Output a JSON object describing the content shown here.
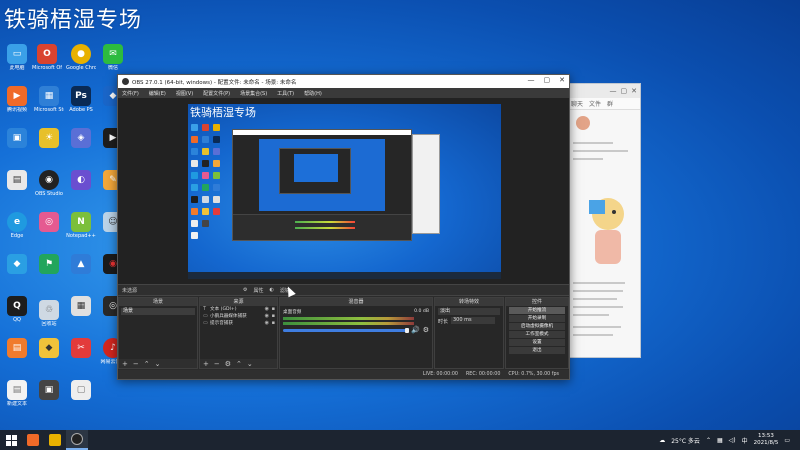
{
  "overlay_title": "铁骑梧湿专场",
  "desktop_icons": [
    {
      "label": "此电脑",
      "icon": "computer-icon",
      "color": "#3aa0e8"
    },
    {
      "label": "Microsoft Office",
      "icon": "office-icon",
      "color": "#d9432f"
    },
    {
      "label": "Google Chrome",
      "icon": "chrome-icon",
      "color": "#e8b100"
    },
    {
      "label": "微信",
      "icon": "wechat-icon",
      "color": "#2dbb3f"
    },
    {
      "label": "腾讯视频",
      "icon": "video-icon",
      "color": "#f06a28"
    },
    {
      "label": "Microsoft Store",
      "icon": "store-icon",
      "color": "#2f7fd6"
    },
    {
      "label": "Adobe PS",
      "icon": "photoshop-icon",
      "color": "#0a2a55"
    },
    {
      "label": "回收站",
      "icon": "recycle-bin-icon",
      "color": "#cfd9e3"
    },
    {
      "label": "OBS Studio",
      "icon": "obs-icon",
      "color": "#222222"
    },
    {
      "label": "Notepad++",
      "icon": "notepad-icon",
      "color": "#7bbf3b"
    },
    {
      "label": "Edge",
      "icon": "edge-icon",
      "color": "#1f9ae0"
    },
    {
      "label": "QQ",
      "icon": "qq-icon",
      "color": "#1d1d1d"
    },
    {
      "label": "网易云音乐",
      "icon": "music-icon",
      "color": "#d3261f"
    },
    {
      "label": "新建文本",
      "icon": "file-icon",
      "color": "#f2f2f2"
    }
  ],
  "chat_window": {
    "tabs": [
      "聊天",
      "文件",
      "群"
    ]
  },
  "obs": {
    "title": "OBS 27.0.1 (64-bit, windows) - 配置文件: 未命名 - 场景: 未命名",
    "menu": [
      "文件(F)",
      "编辑(E)",
      "视图(V)",
      "配置文件(P)",
      "场景集合(S)",
      "工具(T)",
      "帮助(H)"
    ],
    "preview_title": "铁骑梧湿专场",
    "status_label": "未选源",
    "status_props": "属性",
    "status_filters": "滤镜",
    "panels": {
      "scenes": {
        "title": "场景",
        "items": [
          "场景"
        ]
      },
      "sources": {
        "title": "来源",
        "items": [
          {
            "label": "文本 (GDI+)",
            "icon": "text-icon"
          },
          {
            "label": "小鹅兵器媒体捕获",
            "icon": "capture-icon"
          },
          {
            "label": "提示音捕获",
            "icon": "audio-icon"
          }
        ]
      },
      "mixer": {
        "title": "混音器",
        "channel": "桌面音频",
        "db": "0.0 dB"
      },
      "transitions": {
        "title": "转场特效",
        "type": "淡出",
        "duration_label": "时长",
        "duration": "300 ms"
      },
      "controls": {
        "title": "控件",
        "buttons": [
          "开始推流",
          "开始录制",
          "启动虚拟摄像机",
          "工作室模式",
          "设置",
          "退出"
        ]
      }
    },
    "statusbar": {
      "live": "LIVE: 00:00:00",
      "rec": "REC: 00:00:00",
      "cpu": "CPU: 0.7%, 30.00 fps"
    }
  },
  "taskbar": {
    "weather": "25°C 多云",
    "time": "13:53",
    "date": "2021/8/5"
  }
}
